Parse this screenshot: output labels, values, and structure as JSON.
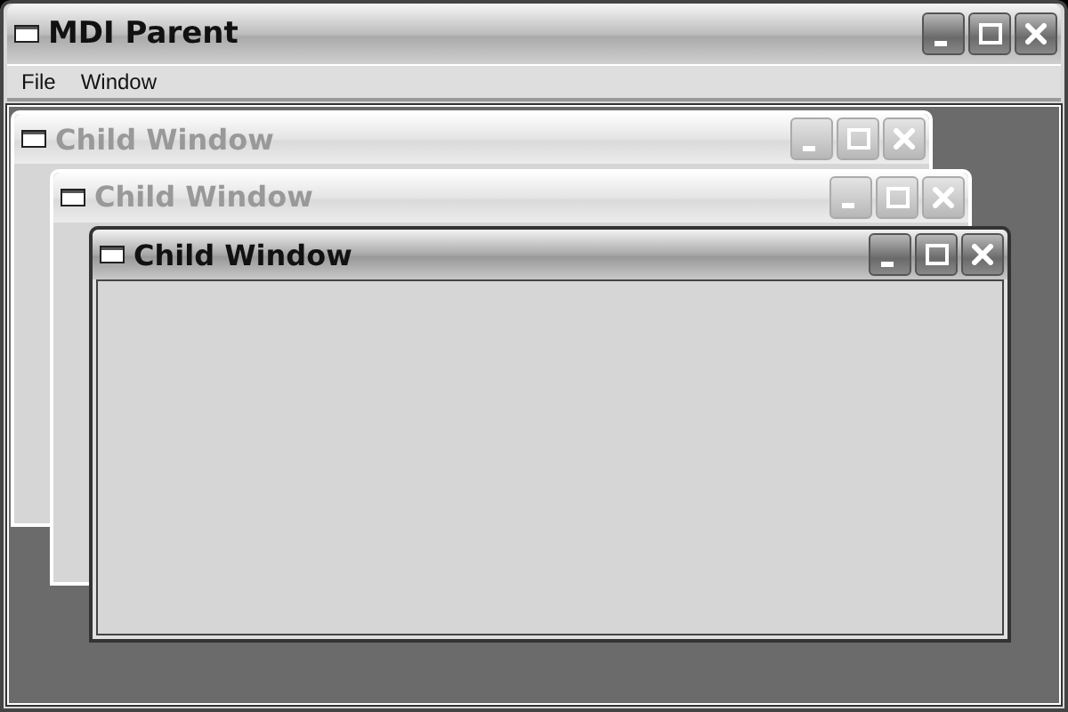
{
  "window": {
    "title": "MDI Parent",
    "active": true
  },
  "menu": [
    {
      "label": "File"
    },
    {
      "label": "Window"
    }
  ],
  "children": [
    {
      "title": "Child Window",
      "active": false
    },
    {
      "title": "Child Window",
      "active": false
    },
    {
      "title": "Child Window",
      "active": true
    }
  ]
}
